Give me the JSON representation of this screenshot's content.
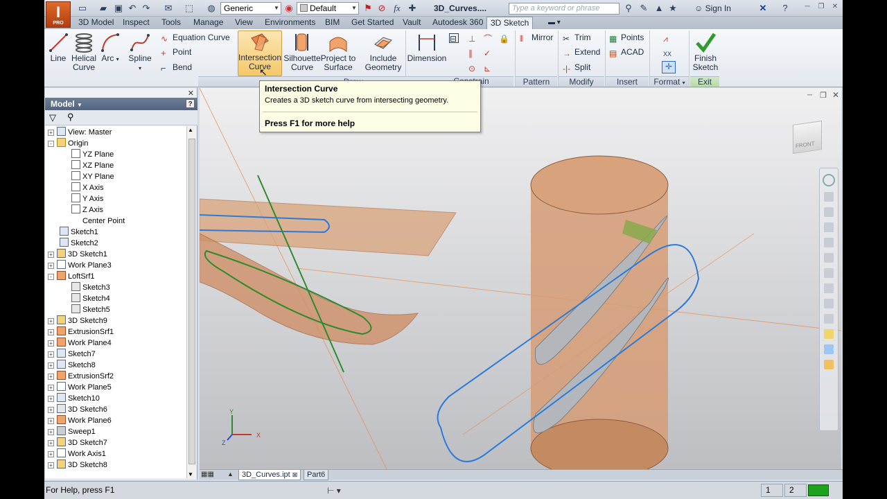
{
  "app": {
    "logo_text": "I",
    "logo_sub": "PRO",
    "document_title": "3D_Curves....",
    "material_combo": "Generic",
    "appearance_combo": "Default",
    "search_placeholder": "Type a keyword or phrase",
    "signin_label": "Sign In"
  },
  "menu_tabs": [
    "3D Model",
    "Inspect",
    "Tools",
    "Manage",
    "View",
    "Environments",
    "BIM",
    "Get Started",
    "Vault",
    "Autodesk 360",
    "3D Sketch"
  ],
  "active_tab": "3D Sketch",
  "ribbon": {
    "draw": {
      "line": "Line",
      "helical_1": "Helical",
      "helical_2": "Curve",
      "arc": "Arc",
      "spline": "Spline",
      "equation_curve": "Equation Curve",
      "point": "Point",
      "bend": "Bend",
      "intersection_1": "Intersection",
      "intersection_2": "Curve",
      "silhouette_1": "Silhouette",
      "silhouette_2": "Curve",
      "project_1": "Project to",
      "project_2": "Surface",
      "include_1": "Include",
      "include_2": "Geometry",
      "dimension": "Dimension"
    },
    "pattern": {
      "mirror": "Mirror"
    },
    "modify": {
      "trim": "Trim",
      "extend": "Extend",
      "split": "Split"
    },
    "insert": {
      "points": "Points",
      "acad": "ACAD"
    },
    "exit": {
      "finish_1": "Finish",
      "finish_2": "Sketch"
    },
    "panels": {
      "draw": "Draw",
      "constrain": "Constrain",
      "pattern": "Pattern",
      "modify": "Modify",
      "insert": "Insert",
      "format": "Format",
      "exit": "Exit"
    }
  },
  "tooltip": {
    "title": "Intersection Curve",
    "description": "Creates a 3D sketch curve from intersecting geometry.",
    "help": "Press F1 for more help"
  },
  "browser": {
    "title": "Model",
    "help_icon": "?",
    "tree": [
      {
        "label": "View: Master",
        "expander": "+"
      },
      {
        "label": "Origin",
        "expander": "-"
      },
      {
        "label": "YZ Plane"
      },
      {
        "label": "XZ Plane"
      },
      {
        "label": "XY Plane"
      },
      {
        "label": "X Axis"
      },
      {
        "label": "Y Axis"
      },
      {
        "label": "Z Axis"
      },
      {
        "label": "Center Point"
      },
      {
        "label": "Sketch1"
      },
      {
        "label": "Sketch2"
      },
      {
        "label": "3D Sketch1",
        "expander": "+"
      },
      {
        "label": "Work Plane3",
        "expander": "+"
      },
      {
        "label": "LoftSrf1",
        "expander": "-"
      },
      {
        "label": "Sketch3"
      },
      {
        "label": "Sketch4"
      },
      {
        "label": "Sketch5"
      },
      {
        "label": "3D Sketch9",
        "expander": "+"
      },
      {
        "label": "ExtrusionSrf1",
        "expander": "+"
      },
      {
        "label": "Work Plane4",
        "expander": "+"
      },
      {
        "label": "Sketch7",
        "expander": "+"
      },
      {
        "label": "Sketch8",
        "expander": "+"
      },
      {
        "label": "ExtrusionSrf2",
        "expander": "+"
      },
      {
        "label": "Work Plane5",
        "expander": "+"
      },
      {
        "label": "Sketch10",
        "expander": "+"
      },
      {
        "label": "3D Sketch6",
        "expander": "+"
      },
      {
        "label": "Work Plane6",
        "expander": "+"
      },
      {
        "label": "Sweep1",
        "expander": "+"
      },
      {
        "label": "3D Sketch7",
        "expander": "+"
      },
      {
        "label": "Work Axis1",
        "expander": "+"
      },
      {
        "label": "3D Sketch8",
        "expander": "+"
      }
    ]
  },
  "viewcube": {
    "face": "FRONT"
  },
  "triad": {
    "x": "X",
    "y": "Y",
    "z": "Z"
  },
  "document_tabs": [
    "3D_Curves.ipt",
    "Part6"
  ],
  "status": {
    "help_text": "For Help, press F1",
    "cell1": "1",
    "cell2": "2"
  }
}
